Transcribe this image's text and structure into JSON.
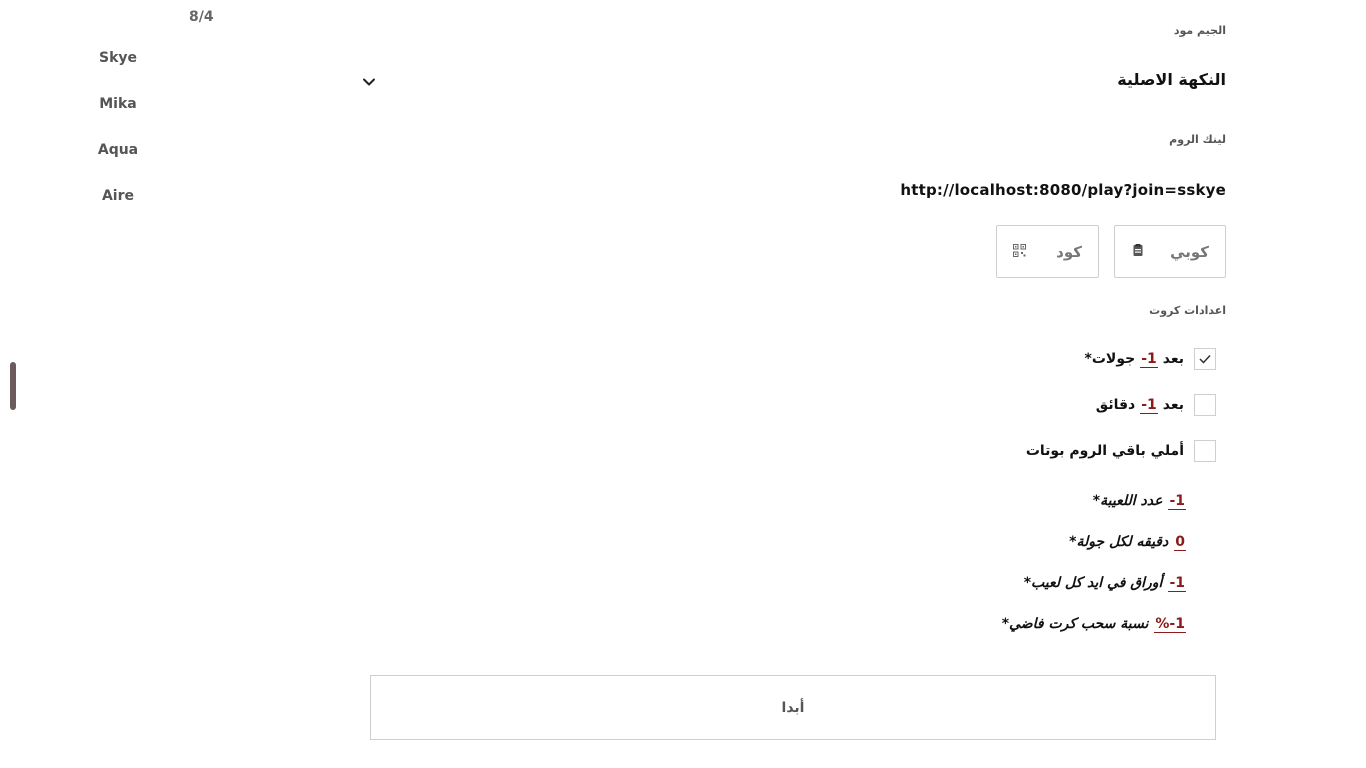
{
  "players": {
    "count": "8/4",
    "names": [
      "Skye",
      "Mika",
      "Aqua",
      "Aire"
    ]
  },
  "settings": {
    "mode_label": "الجيم مود",
    "mode_value": "النكهة الاصلية",
    "link_label": "لينك الروم",
    "link_value": "http://localhost:8080/play?join=sskye",
    "copy_button": "كوبي",
    "qr_button": "كود",
    "cards_label": "اعدادات كروت",
    "options": [
      {
        "prefix": "بعد",
        "value": "1-",
        "suffix": "جولات*",
        "checked": true
      },
      {
        "prefix": "بعد",
        "value": "1-",
        "suffix": "دقائق",
        "checked": false
      },
      {
        "label": "أملي باقي الروم بوتات",
        "checked": false
      }
    ],
    "fields": [
      {
        "value": "1-",
        "label": "عدد اللعيبة*"
      },
      {
        "value": "0",
        "label": "دقيقه لكل جولة*"
      },
      {
        "value": "1-",
        "label": "أوراق في ايد كل لعيب*"
      },
      {
        "value": "1-%",
        "label": "نسبة سحب كرت فاضي*"
      }
    ],
    "start_button": "أبدا"
  },
  "icons": {
    "mode_dropdown": "chevron-down-icon",
    "copy": "clipboard-icon",
    "qr": "qr-code-icon",
    "check": "check-icon"
  },
  "colors": {
    "accent": "#8b1a1a",
    "border": "#cfcfcf",
    "scroll_thumb": "#6d5a5a"
  }
}
